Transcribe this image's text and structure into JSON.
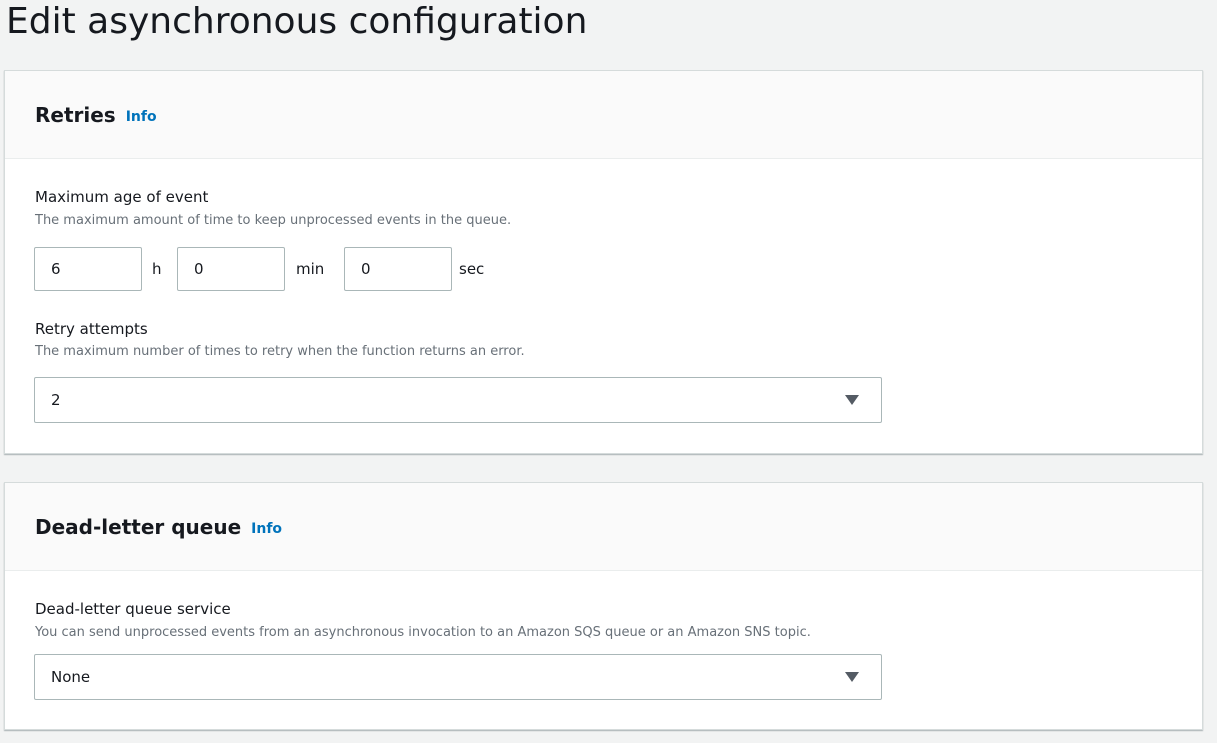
{
  "page": {
    "title": "Edit asynchronous configuration"
  },
  "retries": {
    "title": "Retries",
    "info": "Info",
    "max_age": {
      "label": "Maximum age of event",
      "description": "The maximum amount of time to keep unprocessed events in the queue.",
      "hours": "6",
      "hours_unit": "h",
      "minutes": "0",
      "minutes_unit": "min",
      "seconds": "0",
      "seconds_unit": "sec"
    },
    "retry_attempts": {
      "label": "Retry attempts",
      "description": "The maximum number of times to retry when the function returns an error.",
      "selected": "2"
    }
  },
  "dlq": {
    "title": "Dead-letter queue",
    "info": "Info",
    "service": {
      "label": "Dead-letter queue service",
      "description": "You can send unprocessed events from an asynchronous invocation to an Amazon SQS queue or an Amazon SNS topic.",
      "selected": "None"
    }
  },
  "colors": {
    "background": "#f2f3f3",
    "link": "#0073bb",
    "text": "#16191f",
    "muted": "#687078",
    "border": "#aab7b8"
  },
  "icons": {
    "dropdown": "caret-down-icon"
  }
}
